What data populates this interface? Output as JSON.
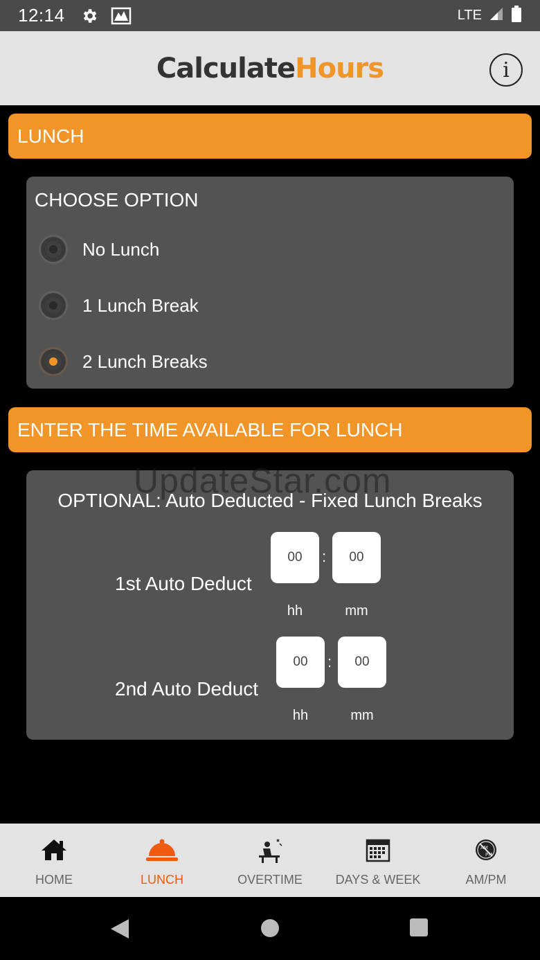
{
  "status_bar": {
    "time": "12:14",
    "network": "LTE"
  },
  "app": {
    "logo_part1": "Calculate",
    "logo_part2": "Hours",
    "info_label": "i"
  },
  "lunch_section": {
    "title": "LUNCH"
  },
  "choose_panel": {
    "title": "CHOOSE OPTION",
    "options": [
      {
        "label": "No Lunch",
        "selected": false
      },
      {
        "label": "1 Lunch Break",
        "selected": false
      },
      {
        "label": "2 Lunch Breaks",
        "selected": true
      }
    ]
  },
  "time_section": {
    "title": "ENTER THE TIME AVAILABLE FOR LUNCH"
  },
  "deduct_panel": {
    "title": "OPTIONAL: Auto Deducted - Fixed Lunch Breaks",
    "rows": [
      {
        "label": "1st Auto Deduct",
        "hh": "00",
        "mm": "00",
        "hh_unit": "hh",
        "mm_unit": "mm",
        "separator": ":"
      },
      {
        "label": "2nd Auto Deduct",
        "hh": "00",
        "mm": "00",
        "hh_unit": "hh",
        "mm_unit": "mm",
        "separator": ":"
      }
    ]
  },
  "watermark": "UpdateStar.com",
  "bottom_nav": {
    "items": [
      {
        "label": "HOME",
        "icon": "home-icon",
        "active": false
      },
      {
        "label": "LUNCH",
        "icon": "cloche-icon",
        "active": true
      },
      {
        "label": "OVERTIME",
        "icon": "worker-desk-icon",
        "active": false
      },
      {
        "label": "DAYS & WEEK",
        "icon": "calendar-icon",
        "active": false
      },
      {
        "label": "AM/PM",
        "icon": "ampm-icon",
        "active": false
      }
    ]
  },
  "colors": {
    "accent": "#f29528",
    "active_nav": "#ee5b10",
    "panel": "#535353",
    "header_bg": "#e3e3e3"
  }
}
